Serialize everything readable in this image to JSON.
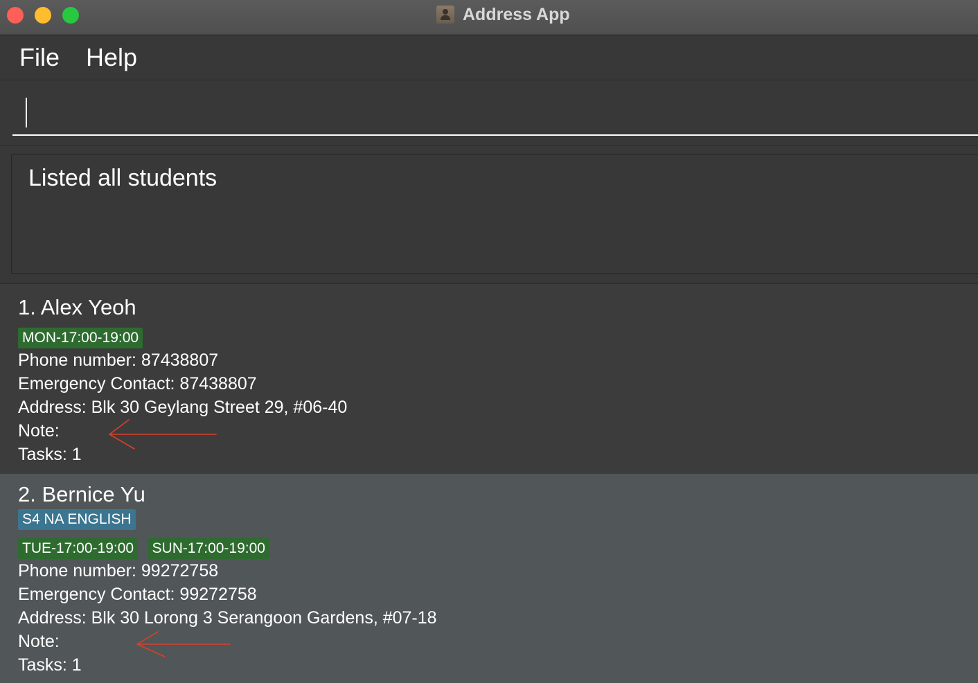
{
  "window": {
    "title": "Address App"
  },
  "menu": {
    "items": [
      "File",
      "Help"
    ]
  },
  "command": {
    "value": "",
    "placeholder": ""
  },
  "result": {
    "text": "Listed all students"
  },
  "students": [
    {
      "name": "1. Alex Yeoh",
      "subject_tags": [],
      "time_tags": [
        "MON-17:00-19:00"
      ],
      "phone": "Phone number: 87438807",
      "emergency": "Emergency Contact: 87438807",
      "address": "Address: Blk 30 Geylang Street 29, #06-40",
      "note": "Note:",
      "tasks": "Tasks: 1"
    },
    {
      "name": "2. Bernice Yu",
      "subject_tags": [
        "S4 NA ENGLISH"
      ],
      "time_tags": [
        "TUE-17:00-19:00",
        "SUN-17:00-19:00"
      ],
      "phone": "Phone number: 99272758",
      "emergency": "Emergency Contact: 99272758",
      "address": "Address: Blk 30 Lorong 3 Serangoon Gardens, #07-18",
      "note": "Note:",
      "tasks": "Tasks: 1"
    }
  ],
  "colors": {
    "time_tag": "#2e6b2f",
    "subject_tag": "#3b7590",
    "annotation_arrow": "#d9412b"
  },
  "icons": {
    "close": "close-traffic-light-icon",
    "minimize": "minimize-traffic-light-icon",
    "maximize": "maximize-traffic-light-icon",
    "app": "address-book-icon",
    "annotation": "arrow-left-icon"
  }
}
